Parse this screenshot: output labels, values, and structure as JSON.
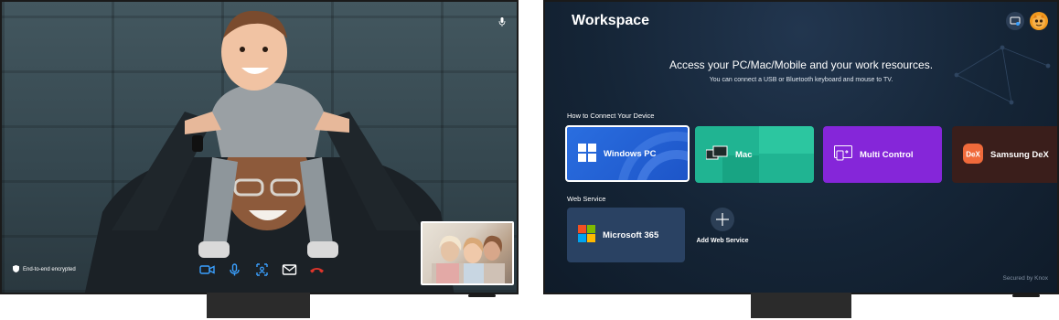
{
  "left_tv": {
    "status": {
      "encryption_text": "End-to-end encrypted"
    },
    "controls": [
      "camera-icon",
      "microphone-icon",
      "screen-share-icon",
      "message-icon",
      "end-call-icon"
    ]
  },
  "right_tv": {
    "title": "Workspace",
    "headline": "Access your PC/Mac/Mobile and your work resources.",
    "subheadline": "You can connect a USB or Bluetooth keyboard and mouse to TV.",
    "connect_section": "How to Connect Your Device",
    "devices": {
      "windows": "Windows PC",
      "mac": "Mac",
      "multi": "Multi Control",
      "dex": "Samsung DeX"
    },
    "web_section": "Web Service",
    "web_services": {
      "microsoft": "Microsoft 365"
    },
    "add_web_service": "Add Web Service",
    "footer": "Secured by Knox"
  },
  "colors": {
    "windows_tile": "#2a6ee0",
    "mac_tile": "#20b492",
    "multi_tile": "#8526d9",
    "dex_tile": "#3a1e1b",
    "ms_tile": "#2a4263"
  }
}
